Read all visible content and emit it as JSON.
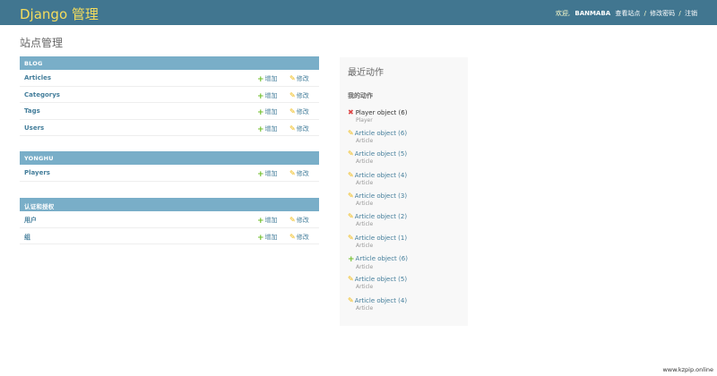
{
  "header": {
    "brand": "Django 管理",
    "welcome": "欢迎,",
    "username": "BANMABA",
    "view_site": "查看站点",
    "change_password": "修改密码",
    "logout": "注销",
    "separator": "/"
  },
  "page_title": "站点管理",
  "modules": [
    {
      "caption": "BLOG",
      "rows": [
        {
          "name": "Articles",
          "add": "增加",
          "change": "修改"
        },
        {
          "name": "Categorys",
          "add": "增加",
          "change": "修改"
        },
        {
          "name": "Tags",
          "add": "增加",
          "change": "修改"
        },
        {
          "name": "Users",
          "add": "增加",
          "change": "修改"
        }
      ]
    },
    {
      "caption": "YONGHU",
      "rows": [
        {
          "name": "Players",
          "add": "增加",
          "change": "修改"
        }
      ]
    },
    {
      "caption": "认证和授权",
      "rows": [
        {
          "name": "用户",
          "add": "增加",
          "change": "修改"
        },
        {
          "name": "组",
          "add": "增加",
          "change": "修改"
        }
      ]
    }
  ],
  "recent_actions": {
    "title": "最近动作",
    "subtitle": "我的动作",
    "items": [
      {
        "action": "delete",
        "object": "Player object (6)",
        "type": "Player"
      },
      {
        "action": "change",
        "object": "Article object (6)",
        "type": "Article"
      },
      {
        "action": "change",
        "object": "Article object (5)",
        "type": "Article"
      },
      {
        "action": "change",
        "object": "Article object (4)",
        "type": "Article"
      },
      {
        "action": "change",
        "object": "Article object (3)",
        "type": "Article"
      },
      {
        "action": "change",
        "object": "Article object (2)",
        "type": "Article"
      },
      {
        "action": "change",
        "object": "Article object (1)",
        "type": "Article"
      },
      {
        "action": "add",
        "object": "Article object (6)",
        "type": "Article"
      },
      {
        "action": "change",
        "object": "Article object (5)",
        "type": "Article"
      },
      {
        "action": "change",
        "object": "Article object (4)",
        "type": "Article"
      }
    ]
  },
  "watermark": "www.kzpip.online",
  "colors": {
    "header": "#417690",
    "brand": "#f5dd5d",
    "caption": "#79aec8",
    "link": "#447e9b",
    "add": "#70bf2b",
    "change": "#efb80b",
    "delete": "#dd4646"
  }
}
